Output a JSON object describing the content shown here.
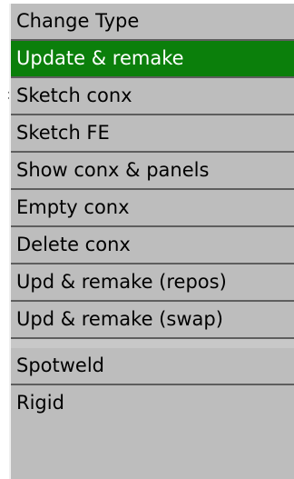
{
  "background_text": ":",
  "menu": {
    "items": [
      {
        "label": "Change Type",
        "selected": false
      },
      {
        "label": "Update & remake",
        "selected": true
      },
      {
        "label": "Sketch conx",
        "selected": false
      },
      {
        "label": "Sketch FE",
        "selected": false
      },
      {
        "label": "Show conx & panels",
        "selected": false
      },
      {
        "label": "Empty conx",
        "selected": false
      },
      {
        "label": "Delete conx",
        "selected": false
      },
      {
        "label": "Upd & remake (repos)",
        "selected": false
      },
      {
        "label": "Upd & remake (swap)",
        "selected": false
      },
      {
        "label": "Spotweld",
        "selected": false
      },
      {
        "label": "Rigid",
        "selected": false
      }
    ]
  },
  "colors": {
    "menu_background": "#bdbdbd",
    "selected_background": "#0b7f0b",
    "selected_text": "#ffffff",
    "item_text": "#000000",
    "divider": "#5e5e5e"
  }
}
